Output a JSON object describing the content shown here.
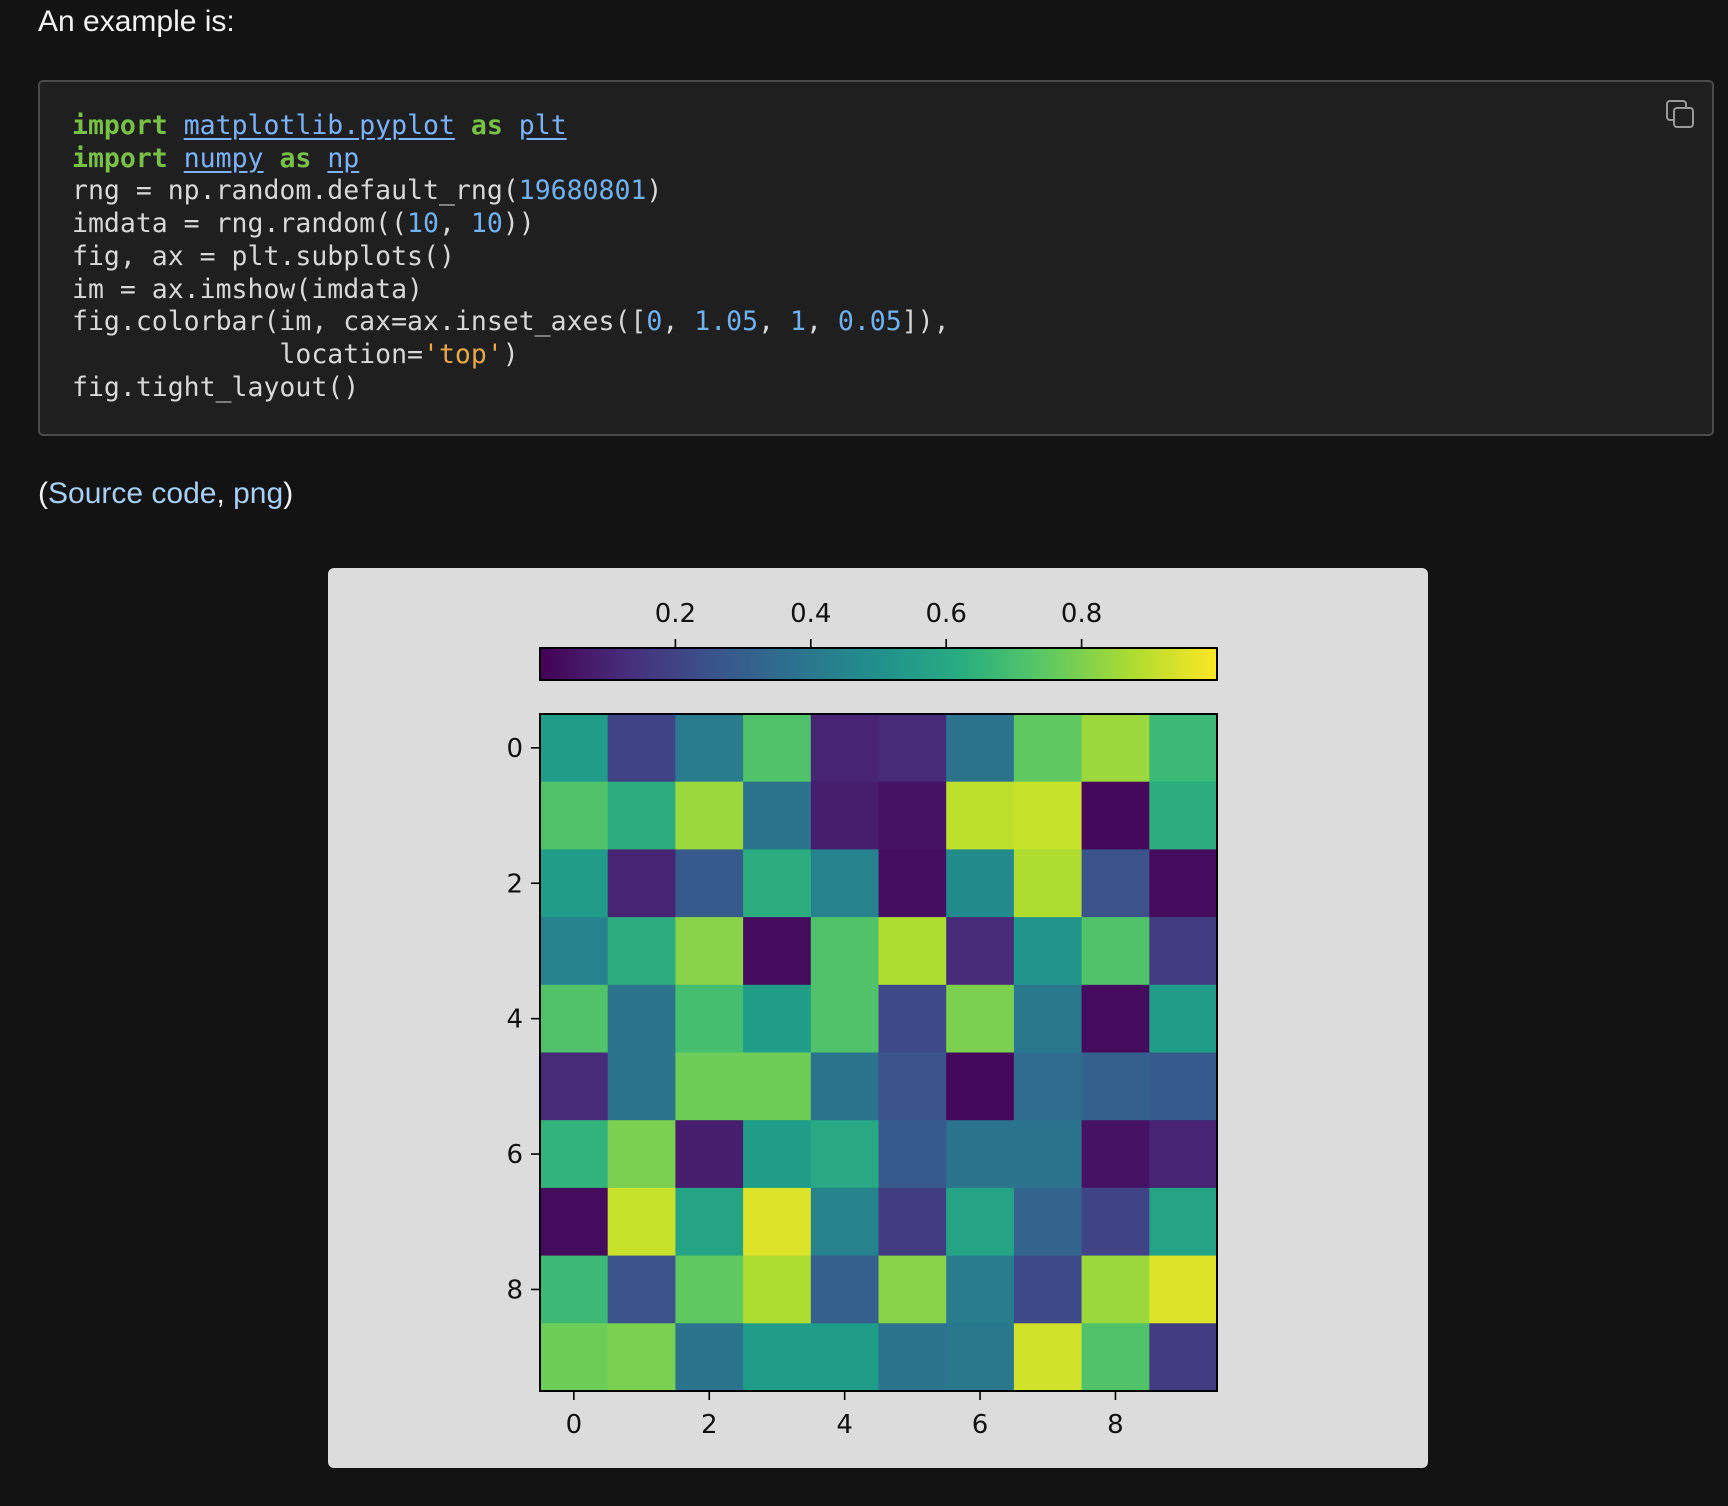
{
  "intro_text": "An example is:",
  "code": {
    "lines": [
      [
        {
          "t": "import",
          "c": "kw"
        },
        {
          "t": " "
        },
        {
          "t": "matplotlib.pyplot",
          "c": "mod"
        },
        {
          "t": " "
        },
        {
          "t": "as",
          "c": "kw"
        },
        {
          "t": " "
        },
        {
          "t": "plt",
          "c": "mod"
        }
      ],
      [
        {
          "t": "import",
          "c": "kw"
        },
        {
          "t": " "
        },
        {
          "t": "numpy",
          "c": "mod"
        },
        {
          "t": " "
        },
        {
          "t": "as",
          "c": "kw"
        },
        {
          "t": " "
        },
        {
          "t": "np",
          "c": "mod"
        }
      ],
      [
        {
          "t": "rng = np.random.default_rng("
        },
        {
          "t": "19680801",
          "c": "num"
        },
        {
          "t": ")"
        }
      ],
      [
        {
          "t": "imdata = rng.random(("
        },
        {
          "t": "10",
          "c": "num"
        },
        {
          "t": ", "
        },
        {
          "t": "10",
          "c": "num"
        },
        {
          "t": "))"
        }
      ],
      [
        {
          "t": "fig, ax = plt.subplots()"
        }
      ],
      [
        {
          "t": "im = ax.imshow(imdata)"
        }
      ],
      [
        {
          "t": "fig.colorbar(im, cax=ax.inset_axes(["
        },
        {
          "t": "0",
          "c": "num"
        },
        {
          "t": ", "
        },
        {
          "t": "1.05",
          "c": "num"
        },
        {
          "t": ", "
        },
        {
          "t": "1",
          "c": "num"
        },
        {
          "t": ", "
        },
        {
          "t": "0.05",
          "c": "num"
        },
        {
          "t": "]),"
        }
      ],
      [
        {
          "t": "             location="
        },
        {
          "t": "'top'",
          "c": "str"
        },
        {
          "t": ")"
        }
      ],
      [
        {
          "t": "fig.tight_layout()"
        }
      ]
    ],
    "copy_icon": "copy-icon"
  },
  "source": {
    "open_paren": "(",
    "source_code_link": "Source code",
    "separator": ", ",
    "png_link": "png",
    "close_paren": ")"
  },
  "chart_data": {
    "type": "heatmap",
    "title": "",
    "colormap": "viridis",
    "x_ticks": [
      "0",
      "2",
      "4",
      "6",
      "8"
    ],
    "y_ticks": [
      "0",
      "2",
      "4",
      "6",
      "8"
    ],
    "colorbar": {
      "location": "top",
      "range": [
        0.0,
        1.0
      ],
      "ticks": [
        "0.2",
        "0.4",
        "0.6",
        "0.8"
      ]
    },
    "values": [
      [
        0.55,
        0.2,
        0.42,
        0.72,
        0.1,
        0.12,
        0.38,
        0.75,
        0.85,
        0.68
      ],
      [
        0.72,
        0.62,
        0.85,
        0.38,
        0.08,
        0.05,
        0.9,
        0.92,
        0.02,
        0.62
      ],
      [
        0.55,
        0.1,
        0.28,
        0.62,
        0.45,
        0.04,
        0.48,
        0.88,
        0.25,
        0.03
      ],
      [
        0.45,
        0.62,
        0.82,
        0.03,
        0.72,
        0.88,
        0.12,
        0.52,
        0.72,
        0.18
      ],
      [
        0.72,
        0.38,
        0.7,
        0.55,
        0.72,
        0.22,
        0.8,
        0.4,
        0.03,
        0.55
      ],
      [
        0.12,
        0.38,
        0.78,
        0.78,
        0.38,
        0.25,
        0.02,
        0.35,
        0.3,
        0.28
      ],
      [
        0.65,
        0.8,
        0.08,
        0.55,
        0.6,
        0.28,
        0.38,
        0.38,
        0.05,
        0.1
      ],
      [
        0.03,
        0.92,
        0.58,
        0.95,
        0.45,
        0.18,
        0.58,
        0.32,
        0.2,
        0.58
      ],
      [
        0.68,
        0.25,
        0.75,
        0.88,
        0.3,
        0.82,
        0.42,
        0.22,
        0.85,
        0.95
      ],
      [
        0.78,
        0.8,
        0.38,
        0.55,
        0.55,
        0.38,
        0.4,
        0.93,
        0.72,
        0.18
      ]
    ]
  }
}
